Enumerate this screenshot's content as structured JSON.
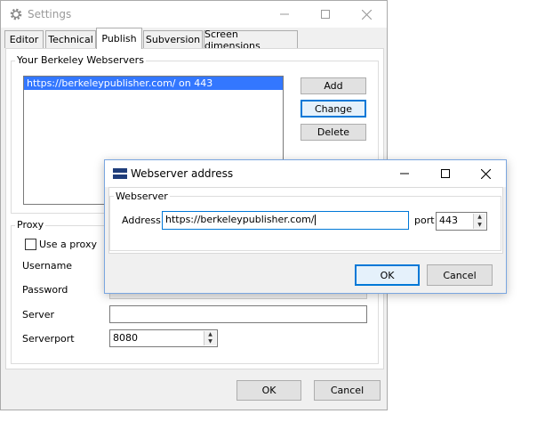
{
  "settings": {
    "title": "Settings",
    "tabs": [
      {
        "label": "Editor"
      },
      {
        "label": "Technical"
      },
      {
        "label": "Publish"
      },
      {
        "label": "Subversion"
      },
      {
        "label": "Screen dimensions"
      }
    ],
    "active_tab": "Publish",
    "webservers": {
      "group_label": "Your Berkeley Webservers",
      "items": [
        "https://berkeleypublisher.com/ on 443"
      ],
      "buttons": {
        "add": "Add",
        "change": "Change",
        "delete": "Delete"
      }
    },
    "proxy": {
      "group_label": "Proxy",
      "use_proxy_label": "Use a proxy",
      "use_proxy_checked": false,
      "username_label": "Username",
      "password_label": "Password",
      "server_label": "Server",
      "server_value": "",
      "serverport_label": "Serverport",
      "serverport_value": "8080"
    },
    "footer": {
      "ok": "OK",
      "cancel": "Cancel"
    }
  },
  "dialog": {
    "title": "Webserver address",
    "group_label": "Webserver",
    "address_label": "Address",
    "address_value": "https://berkeleypublisher.com/",
    "port_label": "port",
    "port_value": "443",
    "ok": "OK",
    "cancel": "Cancel"
  },
  "colors": {
    "selection": "#3377ff",
    "focus_border": "#0078d7",
    "dialog_border": "#7aa6e0"
  },
  "icons": {
    "settings_window": "gear-icon",
    "dialog_window": "app-icon",
    "minimize": "minimize-icon",
    "maximize": "maximize-icon",
    "close": "close-icon",
    "spin_up": "spin-up-icon",
    "spin_down": "spin-down-icon"
  }
}
